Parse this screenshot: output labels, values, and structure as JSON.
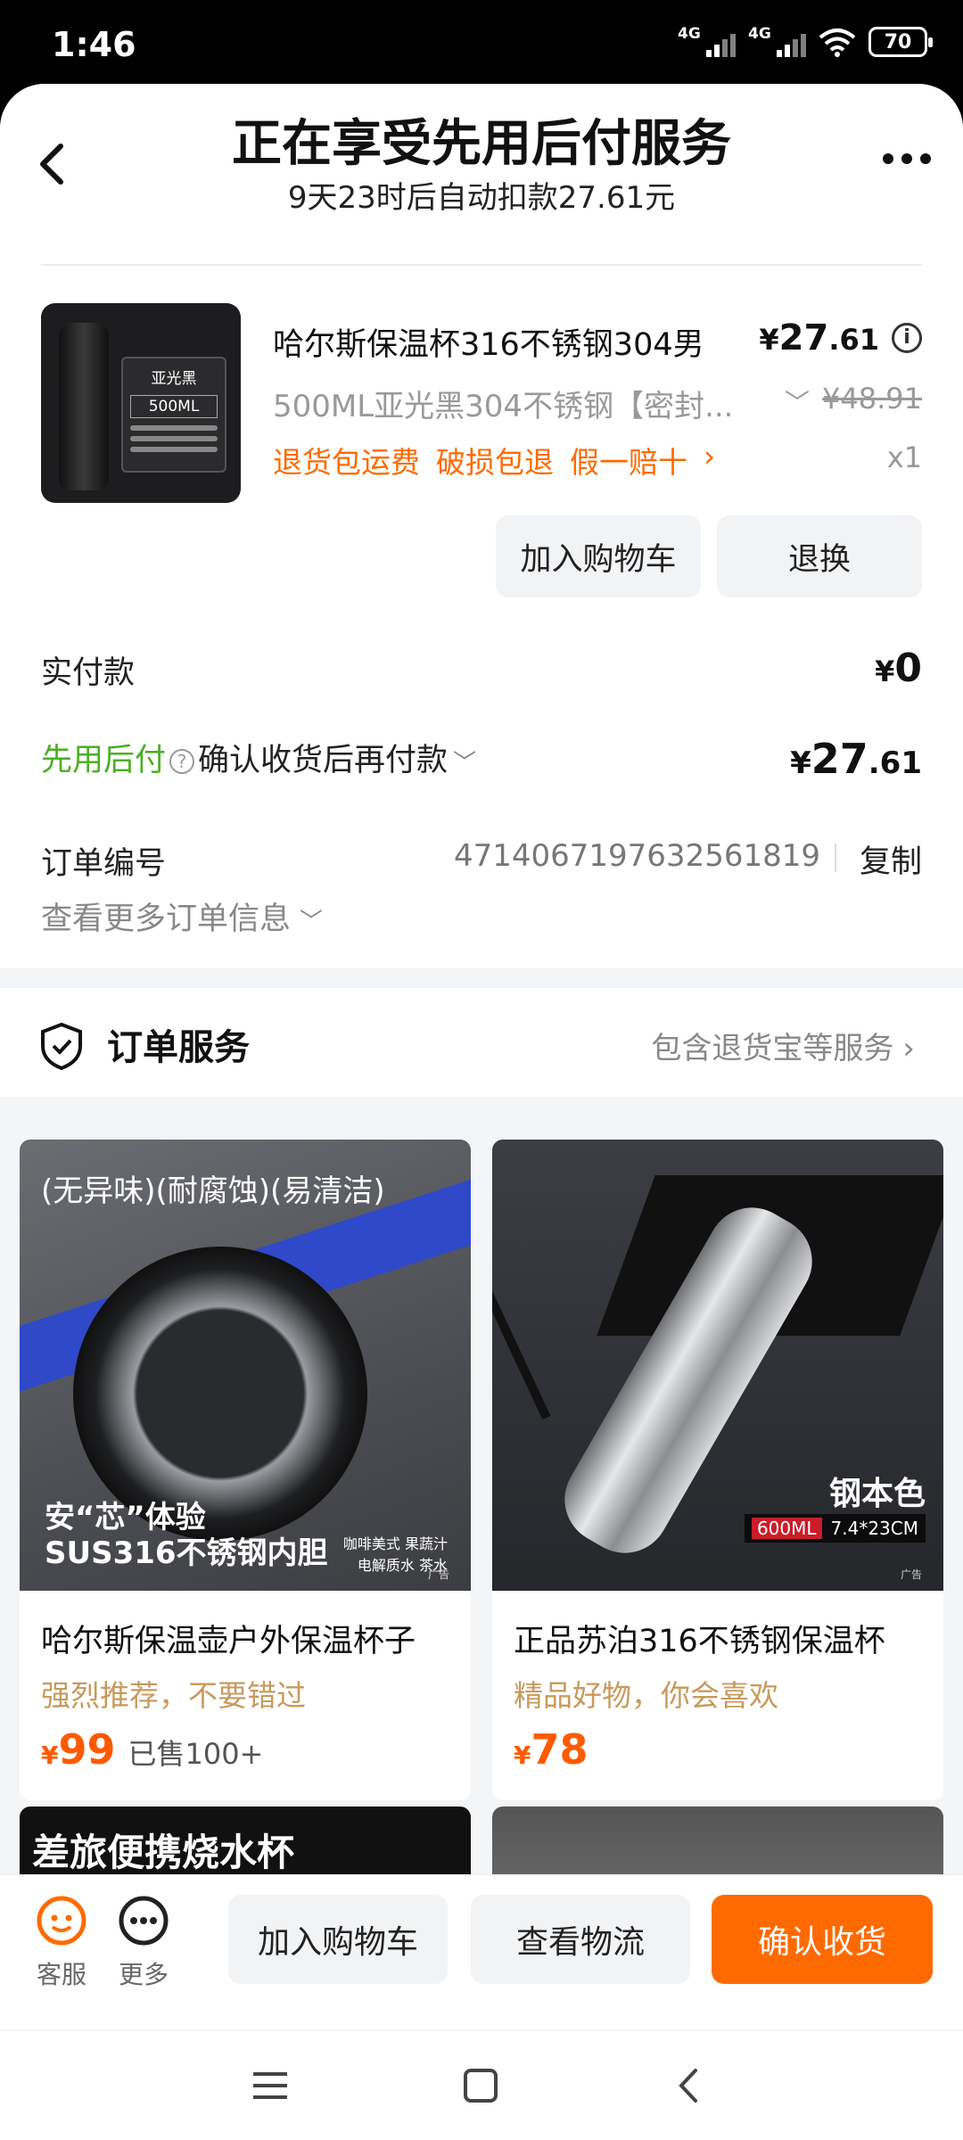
{
  "status_bar": {
    "time": "1:46",
    "signal1_label": "4G",
    "signal2_label": "4G",
    "battery": "70"
  },
  "header": {
    "title": "正在享受先用后付服务",
    "subtitle": "9天23时后自动扣款27.61元"
  },
  "product": {
    "name": "哈尔斯保温杯316不锈钢304男",
    "price_symbol": "¥",
    "price_int": "27",
    "price_dec": ".61",
    "spec": "500ML亚光黑304不锈钢【密封...",
    "original_price": "¥48.91",
    "tags": [
      "退货包运费",
      "破损包退",
      "假一赔十"
    ],
    "quantity": "x1",
    "thumb_badge": "亚光黑",
    "thumb_volume": "500ML",
    "add_cart_label": "加入购物车",
    "return_label": "退换"
  },
  "payment": {
    "paid_label": "实付款",
    "paid_symbol": "¥",
    "paid_amount": "0",
    "bnpl_label": "先用后付",
    "bnpl_desc": "确认收货后再付款",
    "bnpl_symbol": "¥",
    "bnpl_int": "27",
    "bnpl_dec": ".61"
  },
  "order": {
    "number_label": "订单编号",
    "number": "4714067197632561819",
    "copy_label": "复制",
    "more_label": "查看更多订单信息"
  },
  "service": {
    "title": "订单服务",
    "desc": "包含退货宝等服务"
  },
  "recommendations": [
    {
      "image_caption_top": "(无异味)(耐腐蚀)(易清洁)",
      "image_caption_1": "安“芯”体验",
      "image_caption_2": "SUS316不锈钢内胆",
      "image_side_1": "咖啡美式 果蔬汁",
      "image_side_2": "电解质水 茶水",
      "ad": "广告",
      "name": "哈尔斯保温壶户外保温杯子",
      "slogan": "强烈推荐，不要错过",
      "currency": "¥",
      "price": "99",
      "sold": "已售100+"
    },
    {
      "image_caption_1": "钢本色",
      "image_badge": "600ML",
      "image_size": "7.4*23CM",
      "ad": "广告",
      "name": "正品苏泊316不锈钢保温杯",
      "slogan": "精品好物，你会喜欢",
      "currency": "¥",
      "price": "78"
    },
    {
      "image_caption_top": "差旅便携烧水杯"
    },
    {}
  ],
  "bottom_bar": {
    "service_label": "客服",
    "more_label": "更多",
    "add_cart": "加入购物车",
    "logistics": "查看物流",
    "confirm": "确认收货"
  },
  "colors": {
    "accent": "#FF6A00",
    "bnpl_green": "#4CAF24",
    "slogan": "#C89A5C"
  }
}
